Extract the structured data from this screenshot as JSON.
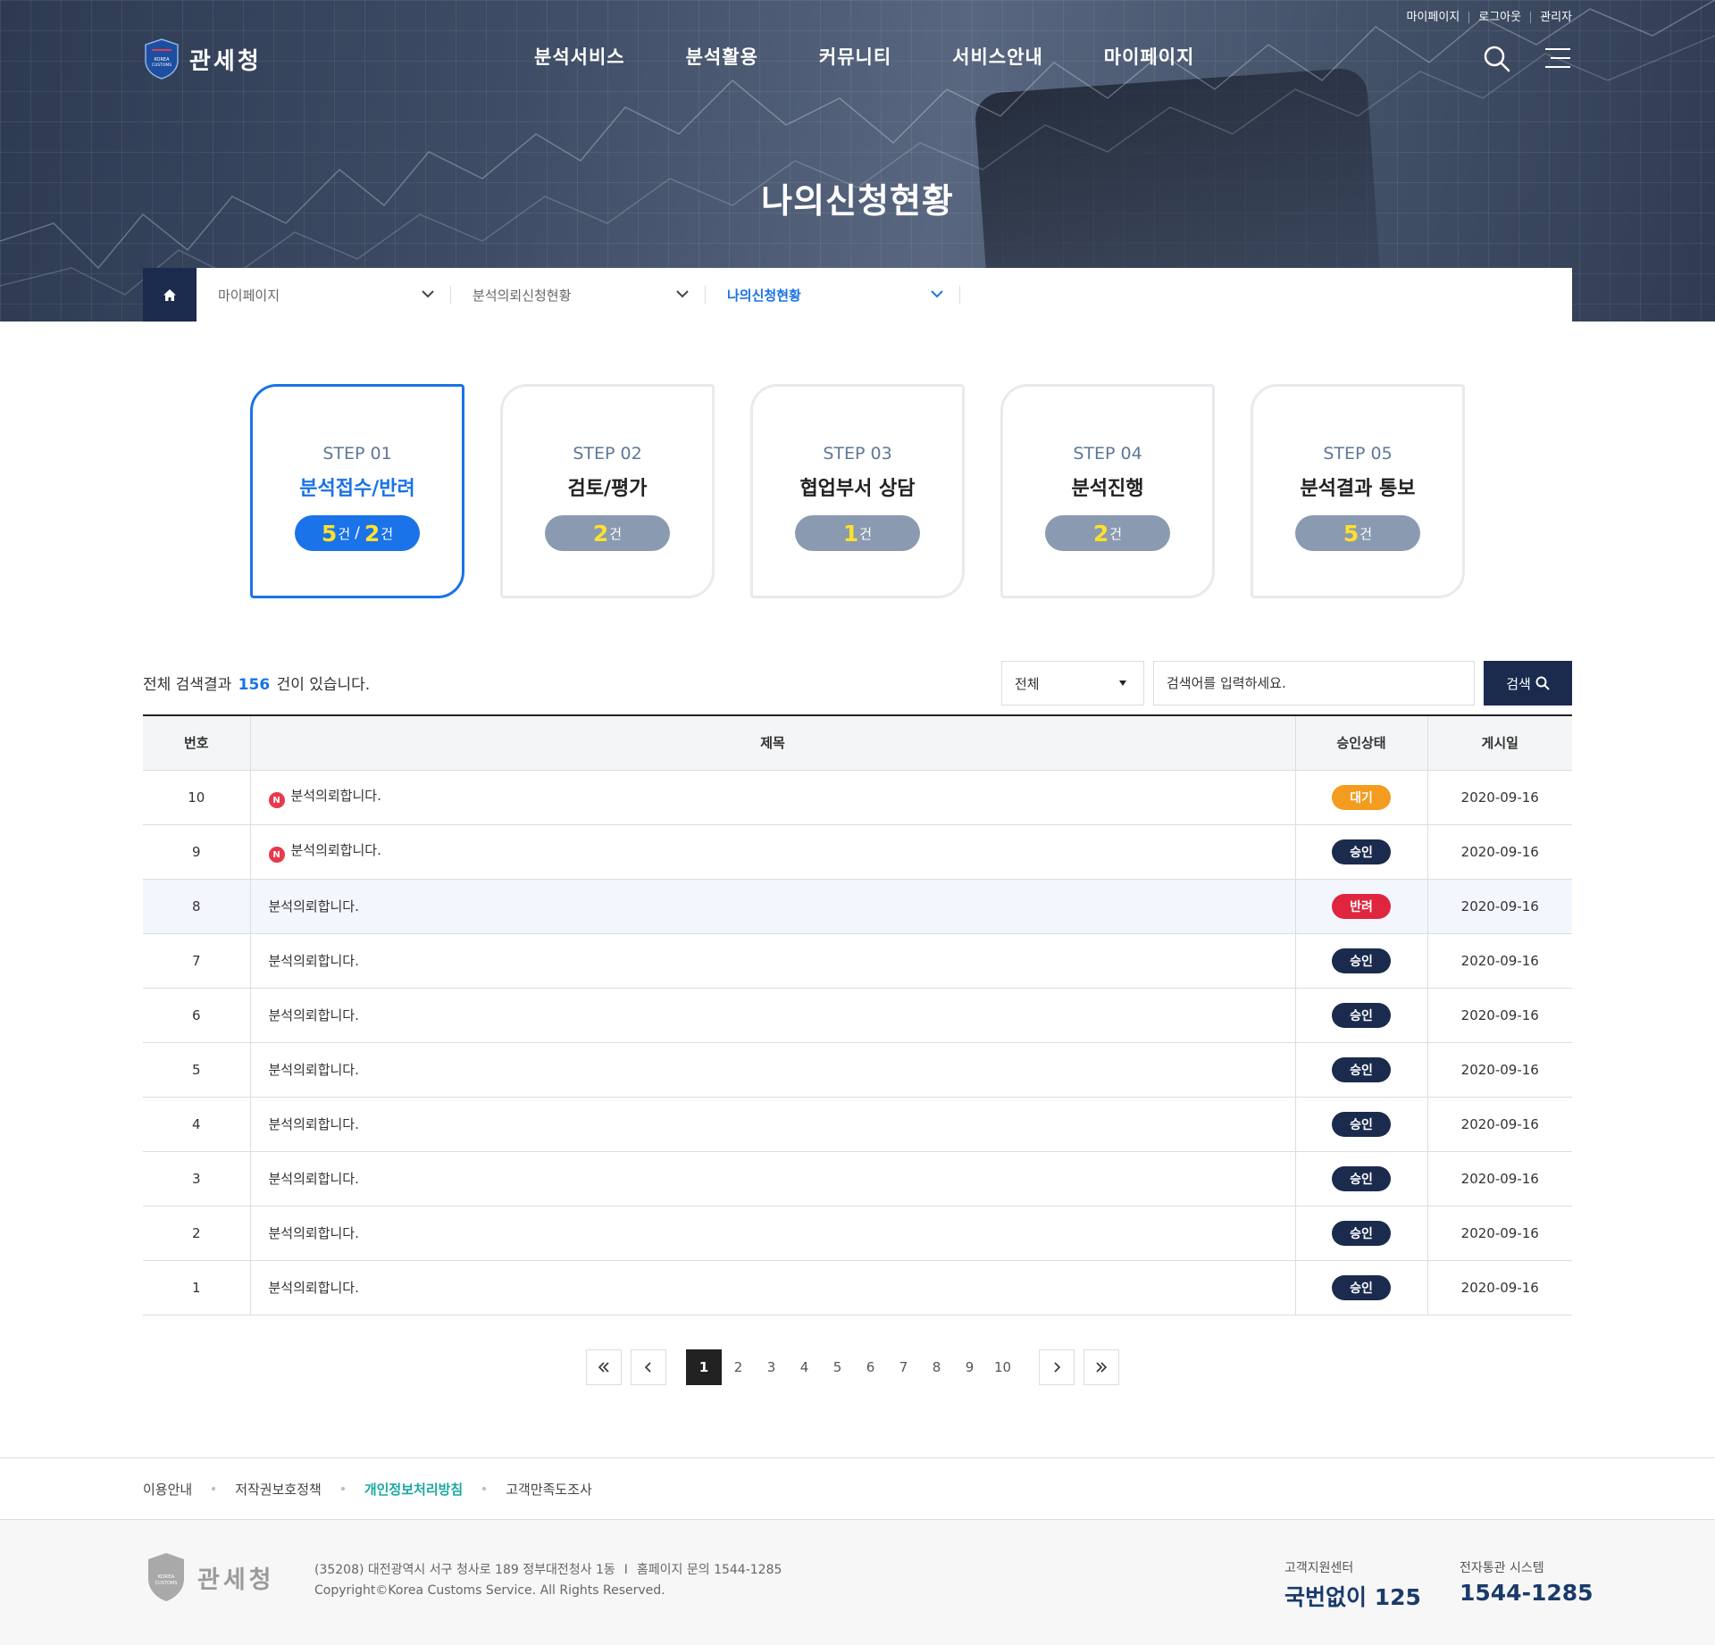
{
  "header": {
    "util_links": [
      "마이페이지",
      "로그아웃",
      "관리자"
    ],
    "logo_text": "관세청",
    "logo_badge": "KOREA CUSTOMS SERVICE",
    "nav": [
      "분석서비스",
      "분석활용",
      "커뮤니티",
      "서비스안내",
      "마이페이지"
    ],
    "page_title": "나의신청현황"
  },
  "breadcrumb": {
    "items": [
      "마이페이지",
      "분석의뢰신청현황",
      "나의신청현황"
    ]
  },
  "steps": [
    {
      "num": "STEP 01",
      "name": "분석접수/반려",
      "count1": "5",
      "count2": "2",
      "unit": "건",
      "sep": "/"
    },
    {
      "num": "STEP 02",
      "name": "검토/평가",
      "count1": "2",
      "unit": "건"
    },
    {
      "num": "STEP 03",
      "name": "협업부서 상담",
      "count1": "1",
      "unit": "건"
    },
    {
      "num": "STEP 04",
      "name": "분석진행",
      "count1": "2",
      "unit": "건"
    },
    {
      "num": "STEP 05",
      "name": "분석결과 통보",
      "count1": "5",
      "unit": "건"
    }
  ],
  "search": {
    "prefix": "전체 검색결과",
    "count": "156",
    "suffix": "건이 있습니다.",
    "select_value": "전체",
    "placeholder": "검색어를 입력하세요.",
    "button": "검색"
  },
  "table": {
    "headers": [
      "번호",
      "제목",
      "승인상태",
      "게시일"
    ],
    "rows": [
      {
        "no": "10",
        "title": "분석의뢰합니다.",
        "is_new": true,
        "status": "대기",
        "status_color": "#f39c1f",
        "date": "2020-09-16"
      },
      {
        "no": "9",
        "title": "분석의뢰합니다.",
        "is_new": true,
        "status": "승인",
        "status_color": "#1a2b4e",
        "date": "2020-09-16"
      },
      {
        "no": "8",
        "title": "분석의뢰합니다.",
        "is_new": false,
        "status": "반려",
        "status_color": "#e0263e",
        "date": "2020-09-16"
      },
      {
        "no": "7",
        "title": "분석의뢰합니다.",
        "is_new": false,
        "status": "승인",
        "status_color": "#1a2b4e",
        "date": "2020-09-16"
      },
      {
        "no": "6",
        "title": "분석의뢰합니다.",
        "is_new": false,
        "status": "승인",
        "status_color": "#1a2b4e",
        "date": "2020-09-16"
      },
      {
        "no": "5",
        "title": "분석의뢰합니다.",
        "is_new": false,
        "status": "승인",
        "status_color": "#1a2b4e",
        "date": "2020-09-16"
      },
      {
        "no": "4",
        "title": "분석의뢰합니다.",
        "is_new": false,
        "status": "승인",
        "status_color": "#1a2b4e",
        "date": "2020-09-16"
      },
      {
        "no": "3",
        "title": "분석의뢰합니다.",
        "is_new": false,
        "status": "승인",
        "status_color": "#1a2b4e",
        "date": "2020-09-16"
      },
      {
        "no": "2",
        "title": "분석의뢰합니다.",
        "is_new": false,
        "status": "승인",
        "status_color": "#1a2b4e",
        "date": "2020-09-16"
      },
      {
        "no": "1",
        "title": "분석의뢰합니다.",
        "is_new": false,
        "status": "승인",
        "status_color": "#1a2b4e",
        "date": "2020-09-16"
      }
    ],
    "new_badge": "N"
  },
  "pagination": {
    "pages": [
      "1",
      "2",
      "3",
      "4",
      "5",
      "6",
      "7",
      "8",
      "9",
      "10"
    ],
    "current": "1"
  },
  "footer": {
    "links": [
      "이용안내",
      "저작권보호정책",
      "개인정보처리방침",
      "고객만족도조사"
    ],
    "address": "(35208) 대전광역시 서구 청사로 189 정부대전청사 1동",
    "homepage": "홈페이지 문의 1544-1285",
    "copyright": "Copyright©Korea Customs Service. All Rights Reserved.",
    "logo_text": "관세청",
    "cs_label": "고객지원센터",
    "cs_value": "국번없이 125",
    "sys_label": "전자통관 시스템",
    "sys_value": "1544-1285"
  },
  "colors": {
    "primary": "#1a73e8",
    "navy": "#1a2b4e",
    "accent_teal": "#19a8a0"
  }
}
